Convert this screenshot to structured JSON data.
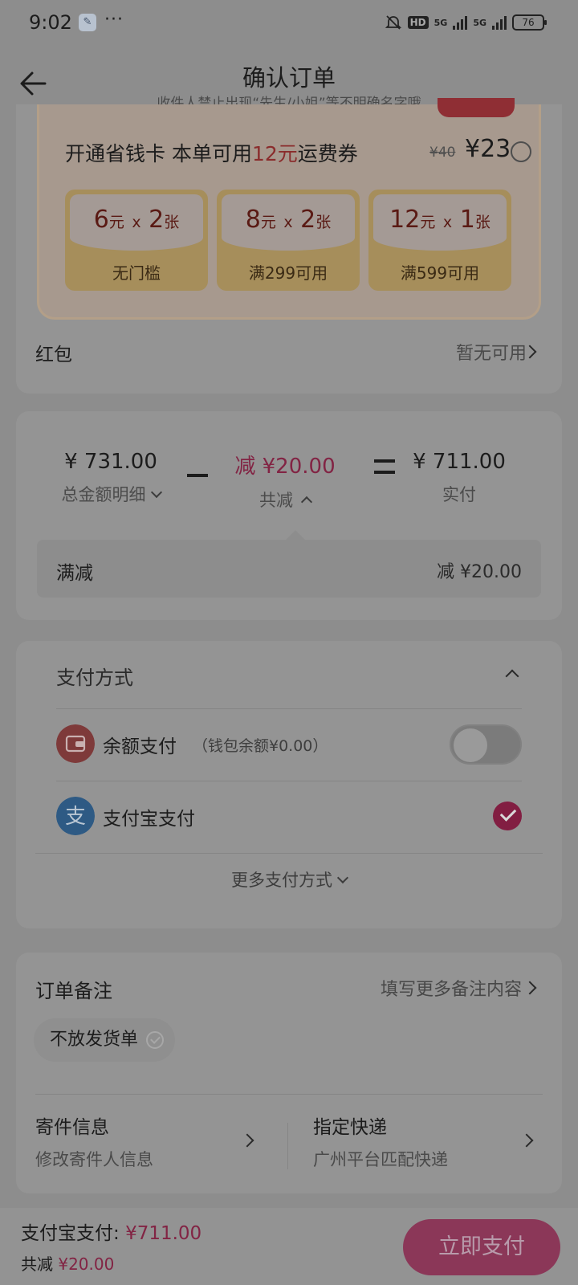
{
  "status_bar": {
    "time": "9:02",
    "hd": "HD",
    "net1": "5G",
    "net2": "5G",
    "battery": "76"
  },
  "header": {
    "title": "确认订单",
    "subtitle": "收件人禁止出现“先生/小姐”等不明确名字哦"
  },
  "coupon": {
    "headline_prefix": "开通省钱卡 本单可用",
    "headline_highlight": "12元",
    "headline_suffix": "运费券",
    "old_price": "¥40",
    "price": "¥23",
    "tickets": [
      {
        "amount": "6",
        "unit": "元",
        "times": "x",
        "count": "2",
        "count_unit": "张",
        "condition": "无门槛"
      },
      {
        "amount": "8",
        "unit": "元",
        "times": "x",
        "count": "2",
        "count_unit": "张",
        "condition": "满299可用"
      },
      {
        "amount": "12",
        "unit": "元",
        "times": "x",
        "count": "1",
        "count_unit": "张",
        "condition": "满599可用"
      }
    ]
  },
  "red_packet": {
    "label": "红包",
    "value": "暂无可用"
  },
  "price_summary": {
    "total_amount": "¥ 731.00",
    "total_label": "总金额明细",
    "discount_amount": "减 ¥20.00",
    "discount_label": "共减",
    "actual_amount": "¥ 711.00",
    "actual_label": "实付",
    "detail_label": "满减",
    "detail_value": "减 ¥20.00"
  },
  "payment": {
    "title": "支付方式",
    "methods": [
      {
        "name": "余额支付",
        "sub": "（钱包余额¥0.00）",
        "selected": false
      },
      {
        "name": "支付宝支付",
        "sub": "",
        "selected": true
      }
    ],
    "more_label": "更多支付方式"
  },
  "notes": {
    "title": "订单备注",
    "more": "填写更多备注内容",
    "chip": "不放发货单",
    "sender_title": "寄件信息",
    "sender_sub": "修改寄件人信息",
    "courier_title": "指定快递",
    "courier_sub": "广州平台匹配快递"
  },
  "bottom_bar": {
    "method_label": "支付宝支付:",
    "amount": "¥711.00",
    "discount_label": "共减",
    "discount_amount": "¥20.00",
    "pay_button": "立即支付"
  },
  "colors": {
    "accent": "#822444",
    "overlay_bg": "#8d8d8d"
  },
  "icons": [
    "wrench-icon",
    "mute-bell-icon",
    "back-arrow-icon",
    "wallet-icon",
    "alipay-icon",
    "check-icon",
    "chevron-right-icon",
    "chevron-down-icon",
    "chevron-up-icon"
  ]
}
